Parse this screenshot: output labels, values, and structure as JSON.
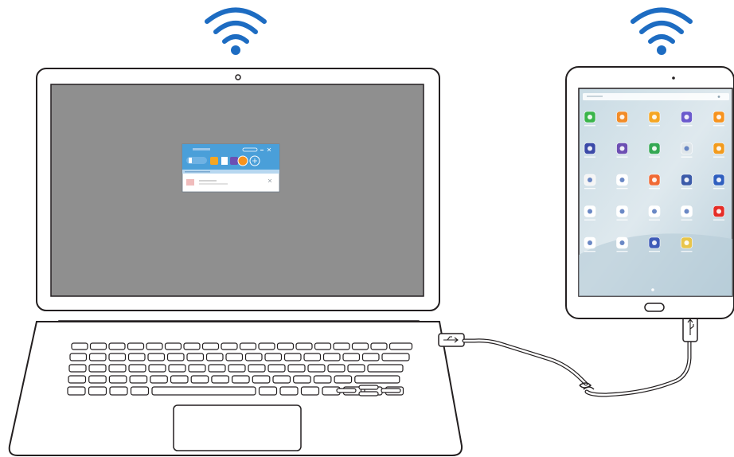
{
  "colors": {
    "wifi": "#1d6cc2",
    "outline": "#231f20",
    "screen_bg": "#8f8f8f",
    "app_header": "#4a9fd9",
    "tablet_wallpaper": "#c9dbe4"
  },
  "icons": {
    "wifi_left": "wifi-icon",
    "wifi_right": "wifi-icon",
    "usb_laptop": "usb-icon",
    "usb_tablet": "usb-icon"
  },
  "tablet_apps": [
    {
      "icon": "phone-icon",
      "color": "#3ab54a"
    },
    {
      "icon": "contacts-icon",
      "color": "#f28c28"
    },
    {
      "icon": "messages-icon",
      "color": "#f5a623"
    },
    {
      "icon": "internet-icon",
      "color": "#6a5acd"
    },
    {
      "icon": "galaxy-apps-icon",
      "color": "#f7931e"
    },
    {
      "icon": "camera-icon",
      "color": "#3b4aa8"
    },
    {
      "icon": "video-icon",
      "color": "#6c4fb3"
    },
    {
      "icon": "calculator-icon",
      "color": "#34a853"
    },
    {
      "icon": "clock-icon",
      "color": "#dfe6ea"
    },
    {
      "icon": "my-files-icon",
      "color": "#f29b1d"
    },
    {
      "icon": "memo-icon",
      "color": "#f5f5f5"
    },
    {
      "icon": "calendar-icon",
      "color": "#ffffff"
    },
    {
      "icon": "email-icon",
      "color": "#f06a35"
    },
    {
      "icon": "settings-icon",
      "color": "#3c5ba9"
    },
    {
      "icon": "samsung-connect-icon",
      "color": "#2f5fbf"
    },
    {
      "icon": "galaxy-apps-store-icon",
      "color": "#ffffff"
    },
    {
      "icon": "chrome-icon",
      "color": "#ffffff"
    },
    {
      "icon": "maps-icon",
      "color": "#ffffff"
    },
    {
      "icon": "play-store-icon",
      "color": "#ffffff"
    },
    {
      "icon": "youtube-icon",
      "color": "#e52d27"
    },
    {
      "icon": "google-folder-icon",
      "color": "#ffffff"
    },
    {
      "icon": "samsung-apps-icon",
      "color": "#ffffff"
    },
    {
      "icon": "music-icon",
      "color": "#3e5bb8"
    },
    {
      "icon": "gallery-icon",
      "color": "#e8c54a"
    }
  ]
}
